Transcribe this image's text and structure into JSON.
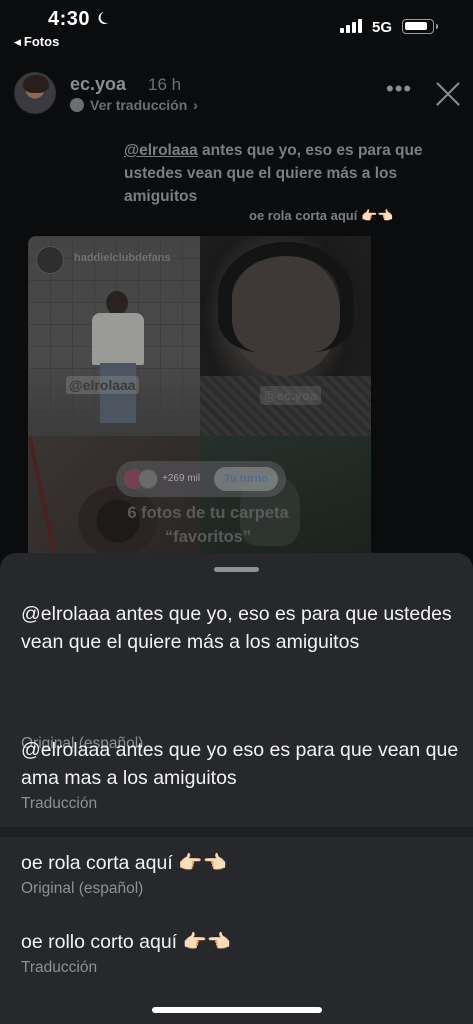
{
  "status_bar": {
    "time": "4:30",
    "back_label": "Fotos",
    "network": "5G"
  },
  "story": {
    "username": "ec.yoa",
    "time_ago": "16 h",
    "translate_label": "Ver traducción",
    "caption_mention": "@elrolaaa",
    "caption_rest": " antes que yo, eso es para que ustedes vean que el quiere más a los amiguitos",
    "sub_caption": "oe rola corta aquí 👉🏻👈🏻",
    "grid": {
      "cell1_username": "haddielclubdefans",
      "cell1_tag": "@elrolaaa",
      "cell2_tag": "@ec.yoa",
      "collab_count": "+269 mil",
      "collab_turn": "Tu turno",
      "overlay_title": "6 fotos de tu carpeta “favoritos”"
    }
  },
  "sheet": {
    "items": [
      {
        "text": "@elrolaaa antes que yo, eso es para que ustedes vean que el quiere más a los amiguitos",
        "label": "Original (español)"
      },
      {
        "text": "@elrolaaa antes que yo eso es para que vean que ama mas a los amiguitos",
        "label": "Traducción"
      },
      {
        "text": "oe rola corta aquí 👉🏻👈🏻",
        "label": "Original (español)"
      },
      {
        "text": "oe rollo corto aquí 👉🏻👈🏻",
        "label": "Traducción"
      }
    ]
  },
  "icons": [
    "moon-icon",
    "signal-icon",
    "battery-icon",
    "globe-icon",
    "more-options-icon",
    "close-icon"
  ]
}
